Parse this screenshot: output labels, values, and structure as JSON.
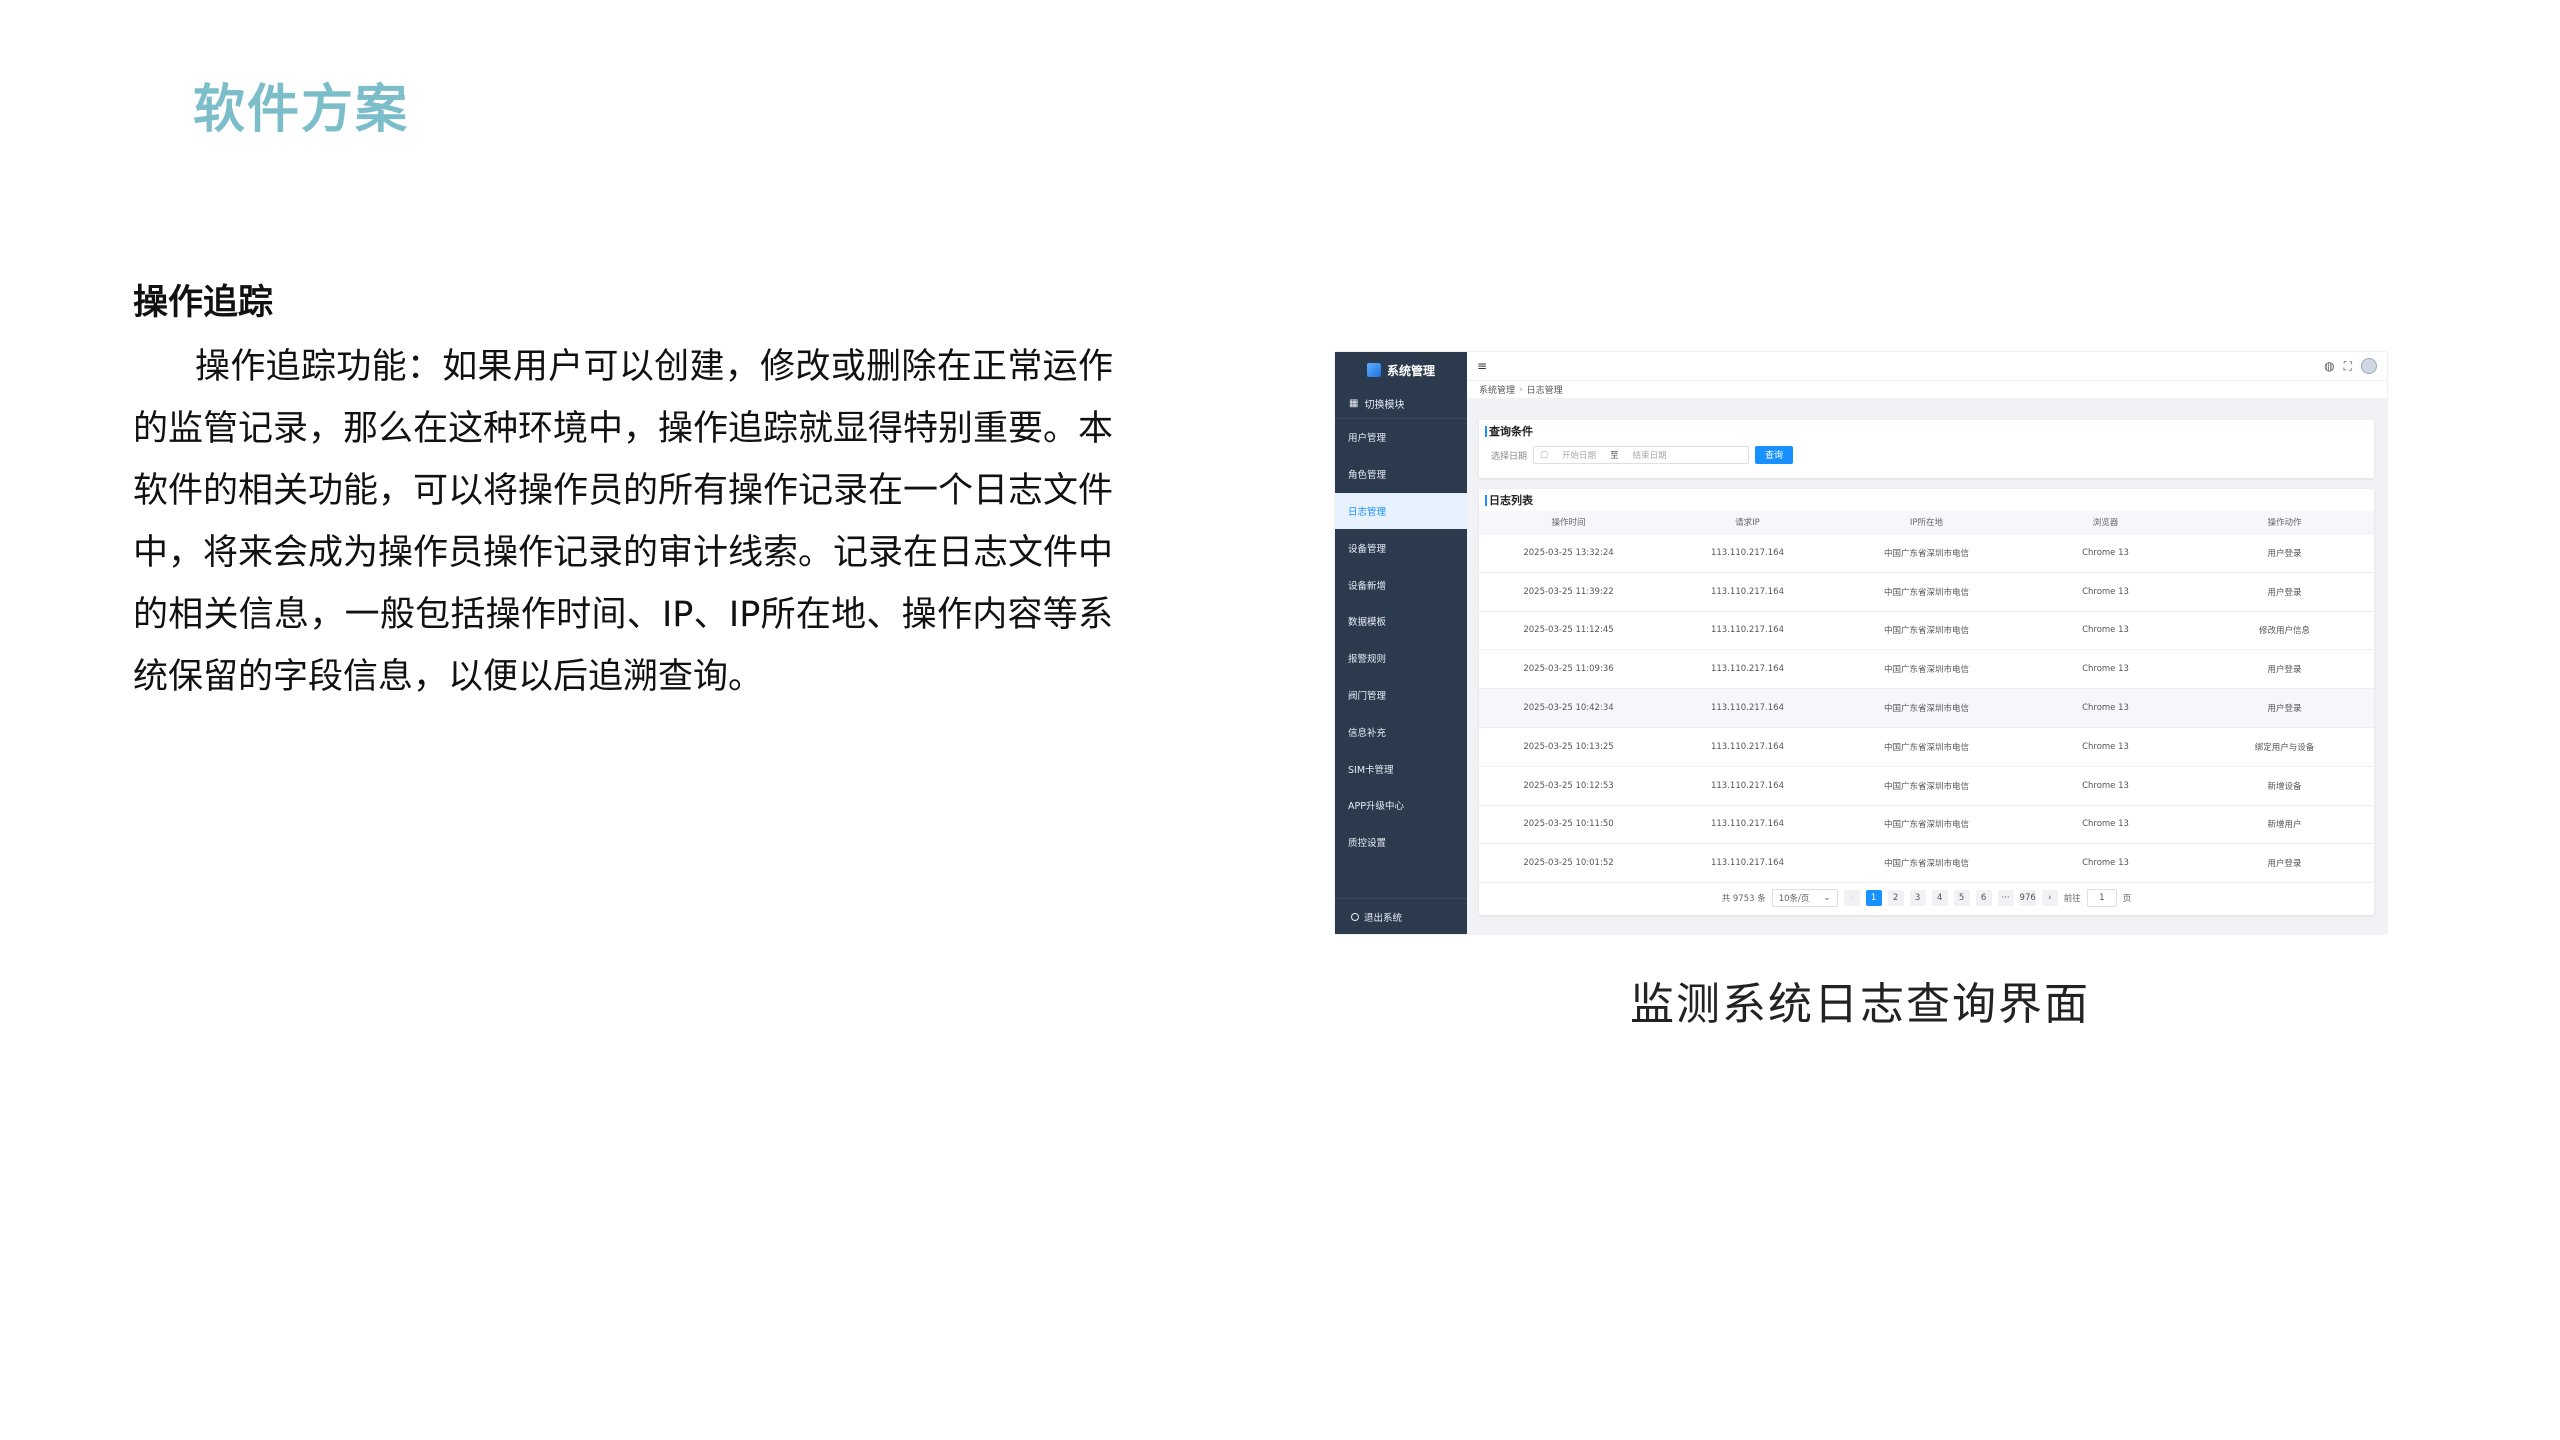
{
  "slide": {
    "title": "软件方案",
    "section_heading": "操作追踪",
    "body": "操作追踪功能：如果用户可以创建，修改或删除在正常运作的监管记录，那么在这种环境中，操作追踪就显得特别重要。本软件的相关功能，可以将操作员的所有操作记录在一个日志文件中，将来会成为操作员操作记录的审计线索。记录在日志文件中的相关信息，一般包括操作时间、IP、IP所在地、操作内容等系统保留的字段信息，以便以后追溯查询。",
    "caption": "监测系统日志查询界面"
  },
  "app": {
    "brand": "系统管理",
    "switch_module": "切换模块",
    "menu": [
      {
        "label": "用户管理",
        "active": false
      },
      {
        "label": "角色管理",
        "active": false
      },
      {
        "label": "日志管理",
        "active": true
      },
      {
        "label": "设备管理",
        "active": false
      },
      {
        "label": "设备新增",
        "active": false
      },
      {
        "label": "数据模板",
        "active": false
      },
      {
        "label": "报警规则",
        "active": false
      },
      {
        "label": "阀门管理",
        "active": false
      },
      {
        "label": "信息补充",
        "active": false
      },
      {
        "label": "SIM卡管理",
        "active": false
      },
      {
        "label": "APP升级中心",
        "active": false
      },
      {
        "label": "质控设置",
        "active": false
      }
    ],
    "logout": "退出系统",
    "breadcrumb": [
      "系统管理",
      "日志管理"
    ],
    "query": {
      "title": "查询条件",
      "date_label": "选择日期",
      "start_placeholder": "开始日期",
      "range_sep": "至",
      "end_placeholder": "结束日期",
      "button": "查询"
    },
    "log": {
      "title": "日志列表",
      "columns": [
        "操作时间",
        "请求IP",
        "IP所在地",
        "浏览器",
        "操作动作"
      ],
      "rows": [
        [
          "2025-03-25 13:32:24",
          "113.110.217.164",
          "中国广东省深圳市电信",
          "Chrome 13",
          "用户登录"
        ],
        [
          "2025-03-25 11:39:22",
          "113.110.217.164",
          "中国广东省深圳市电信",
          "Chrome 13",
          "用户登录"
        ],
        [
          "2025-03-25 11:12:45",
          "113.110.217.164",
          "中国广东省深圳市电信",
          "Chrome 13",
          "修改用户信息"
        ],
        [
          "2025-03-25 11:09:36",
          "113.110.217.164",
          "中国广东省深圳市电信",
          "Chrome 13",
          "用户登录"
        ],
        [
          "2025-03-25 10:42:34",
          "113.110.217.164",
          "中国广东省深圳市电信",
          "Chrome 13",
          "用户登录"
        ],
        [
          "2025-03-25 10:13:25",
          "113.110.217.164",
          "中国广东省深圳市电信",
          "Chrome 13",
          "绑定用户与设备"
        ],
        [
          "2025-03-25 10:12:53",
          "113.110.217.164",
          "中国广东省深圳市电信",
          "Chrome 13",
          "新增设备"
        ],
        [
          "2025-03-25 10:11:50",
          "113.110.217.164",
          "中国广东省深圳市电信",
          "Chrome 13",
          "新增用户"
        ],
        [
          "2025-03-25 10:01:52",
          "113.110.217.164",
          "中国广东省深圳市电信",
          "Chrome 13",
          "用户登录"
        ]
      ],
      "highlight_row": 4
    },
    "pagination": {
      "total": "共 9753 条",
      "page_size": "10条/页",
      "prev": "‹",
      "pages": [
        "1",
        "2",
        "3",
        "4",
        "5",
        "6",
        "···",
        "976"
      ],
      "active_page": "1",
      "next": "›",
      "goto_label": "前往",
      "goto_value": "1",
      "goto_suffix": "页"
    }
  }
}
